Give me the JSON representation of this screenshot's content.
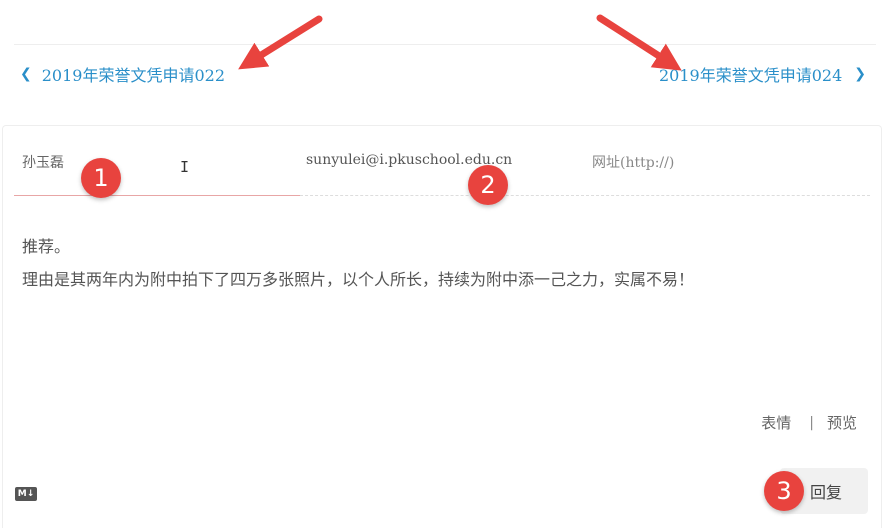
{
  "nav": {
    "prev_label": "2019年荣誉文凭申请022",
    "next_label": "2019年荣誉文凭申请024",
    "prev_icon": "chevron-left-icon",
    "next_icon": "chevron-right-icon",
    "link_color": "#2a8fc9"
  },
  "form": {
    "name_value": "孙玉磊",
    "email_value": "sunyulei@i.pkuschool.edu.cn",
    "url_placeholder": "网址(http://)",
    "comment_lines": [
      "推荐。",
      "理由是其两年内为附中拍下了四万多张照片，以个人所长，持续为附中添一己之力，实属不易！"
    ]
  },
  "tools": {
    "emoji_label": "表情",
    "separator": "|",
    "preview_label": "预览"
  },
  "markdown_icon": "markdown-icon",
  "reply_label": "回复",
  "badges": [
    "1",
    "2",
    "3"
  ],
  "colors": {
    "badge": "#e8433e",
    "arrow": "#e8433e"
  }
}
